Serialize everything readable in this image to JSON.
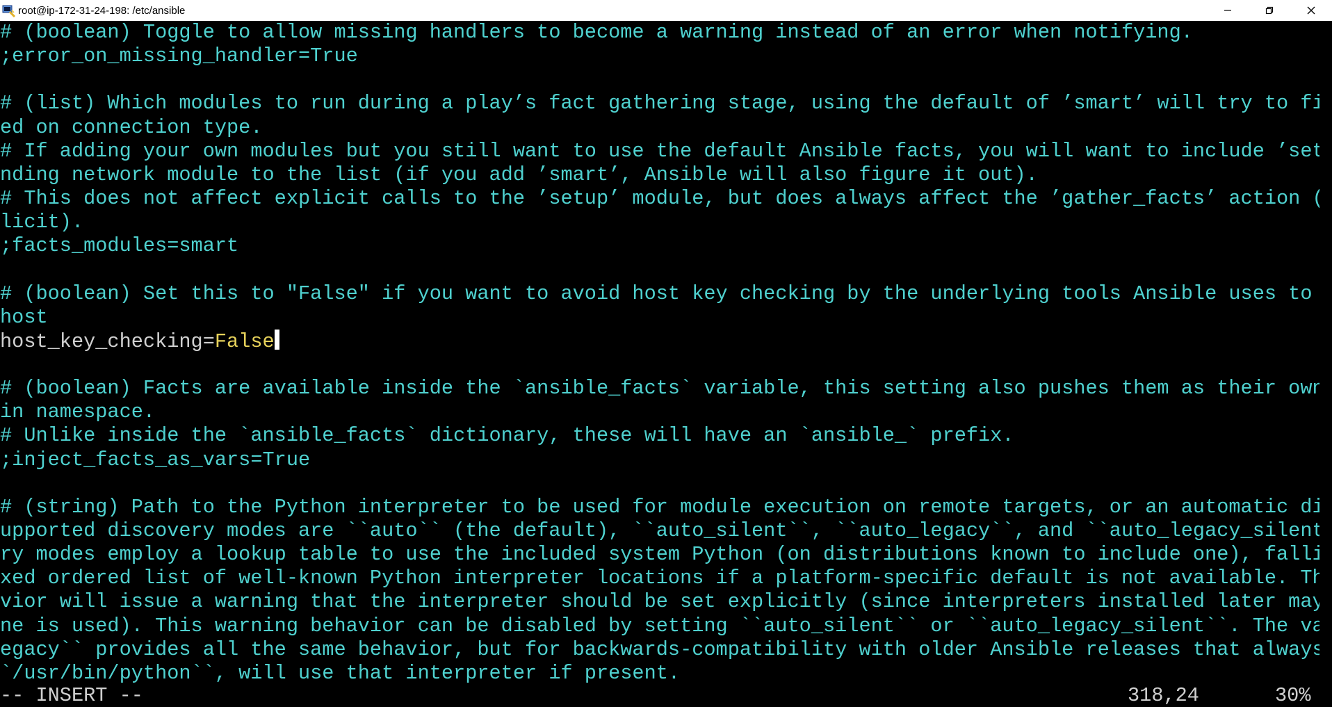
{
  "window": {
    "title": "root@ip-172-31-24-198: /etc/ansible",
    "app_icon": "putty-terminal-icon",
    "controls": [
      "minimize-icon",
      "restore-icon",
      "close-icon"
    ]
  },
  "editor": {
    "lines": [
      "# (boolean) Toggle to allow missing handlers to become a warning instead of an error when notifying.",
      ";error_on_missing_handler=True",
      "",
      "# (list) Which modules to run during a play’s fact gathering stage, using the default of ’smart’ will try to figure it out bas",
      "ed on connection type.",
      "# If adding your own modules but you still want to use the default Ansible facts, you will want to include ’setup’ or correspo",
      "nding network module to the list (if you add ’smart’, Ansible will also figure it out).",
      "# This does not affect explicit calls to the ’setup’ module, but does always affect the ’gather_facts’ action (implicit or exp",
      "licit).",
      ";facts_modules=smart",
      "",
      "# (boolean) Set this to ″False″ if you want to avoid host key checking by the underlying tools Ansible uses to connect to the",
      "host",
      "",
      "",
      "# (boolean) Facts are available inside the `ansible_facts` variable, this setting also pushes them as their own vars in the ma",
      "in namespace.",
      "# Unlike inside the `ansible_facts` dictionary, these will have an `ansible_` prefix.",
      ";inject_facts_as_vars=True",
      "",
      "# (string) Path to the Python interpreter to be used for module execution on remote targets, or an automatic discovery mode. S",
      "upported discovery modes are ``auto`` (the default), ``auto_silent``, ``auto_legacy``, and ``auto_legacy_silent``. All discove",
      "ry modes employ a lookup table to use the included system Python (on distributions known to include one), falling back to a fi",
      "xed ordered list of well-known Python interpreter locations if a platform-specific default is not available. The fallback beha",
      "vior will issue a warning that the interpreter should be set explicitly (since interpreters installed later may change which o",
      "ne is used). This warning behavior can be disabled by setting ``auto_silent`` or ``auto_legacy_silent``. The value of ``auto_l",
      "egacy`` provides all the same behavior, but for backwards-compatibility with older Ansible releases that always defaulted to `",
      "`/usr/bin/python``, will use that interpreter if present."
    ],
    "active_line": {
      "key": "host_key_checking",
      "eq": "=",
      "value": "False"
    }
  },
  "status": {
    "mode": "-- INSERT --",
    "position": "318,24",
    "percent": "30%"
  },
  "colors": {
    "comment": "#4fd1cf",
    "text": "#d0d0d0",
    "value": "#e6d15a",
    "background": "#000000"
  }
}
